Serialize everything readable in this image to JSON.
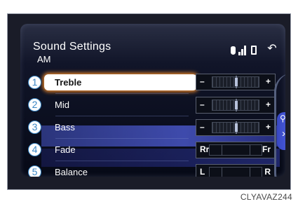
{
  "header": {
    "title": "Sound Settings",
    "subtitle": "AM",
    "icons": [
      "bluetooth-icon",
      "signal-icon",
      "battery-icon"
    ],
    "back_icon": "back-arrow-icon"
  },
  "settings": [
    {
      "number": "1",
      "label": "Treble",
      "type": "level",
      "left_mark": "–",
      "right_mark": "+",
      "selected": true
    },
    {
      "number": "2",
      "label": "Mid",
      "type": "level",
      "left_mark": "–",
      "right_mark": "+",
      "selected": false
    },
    {
      "number": "3",
      "label": "Bass",
      "type": "level",
      "left_mark": "–",
      "right_mark": "+",
      "selected": false
    },
    {
      "number": "4",
      "label": "Fade",
      "type": "balance",
      "left_mark": "Rr",
      "right_mark": "Fr",
      "selected": false
    },
    {
      "number": "5",
      "label": "Balance",
      "type": "balance",
      "left_mark": "L",
      "right_mark": "R",
      "selected": false
    }
  ],
  "side_panel": {
    "zoom_icon": "zoom-icon",
    "arrow_icon": "chevron-right-icon"
  },
  "colors": {
    "accent": "#f08a2a",
    "highlight": "#4d5fe0",
    "badge": "#3a86c4"
  },
  "image_code": "CLYAVAZ244"
}
